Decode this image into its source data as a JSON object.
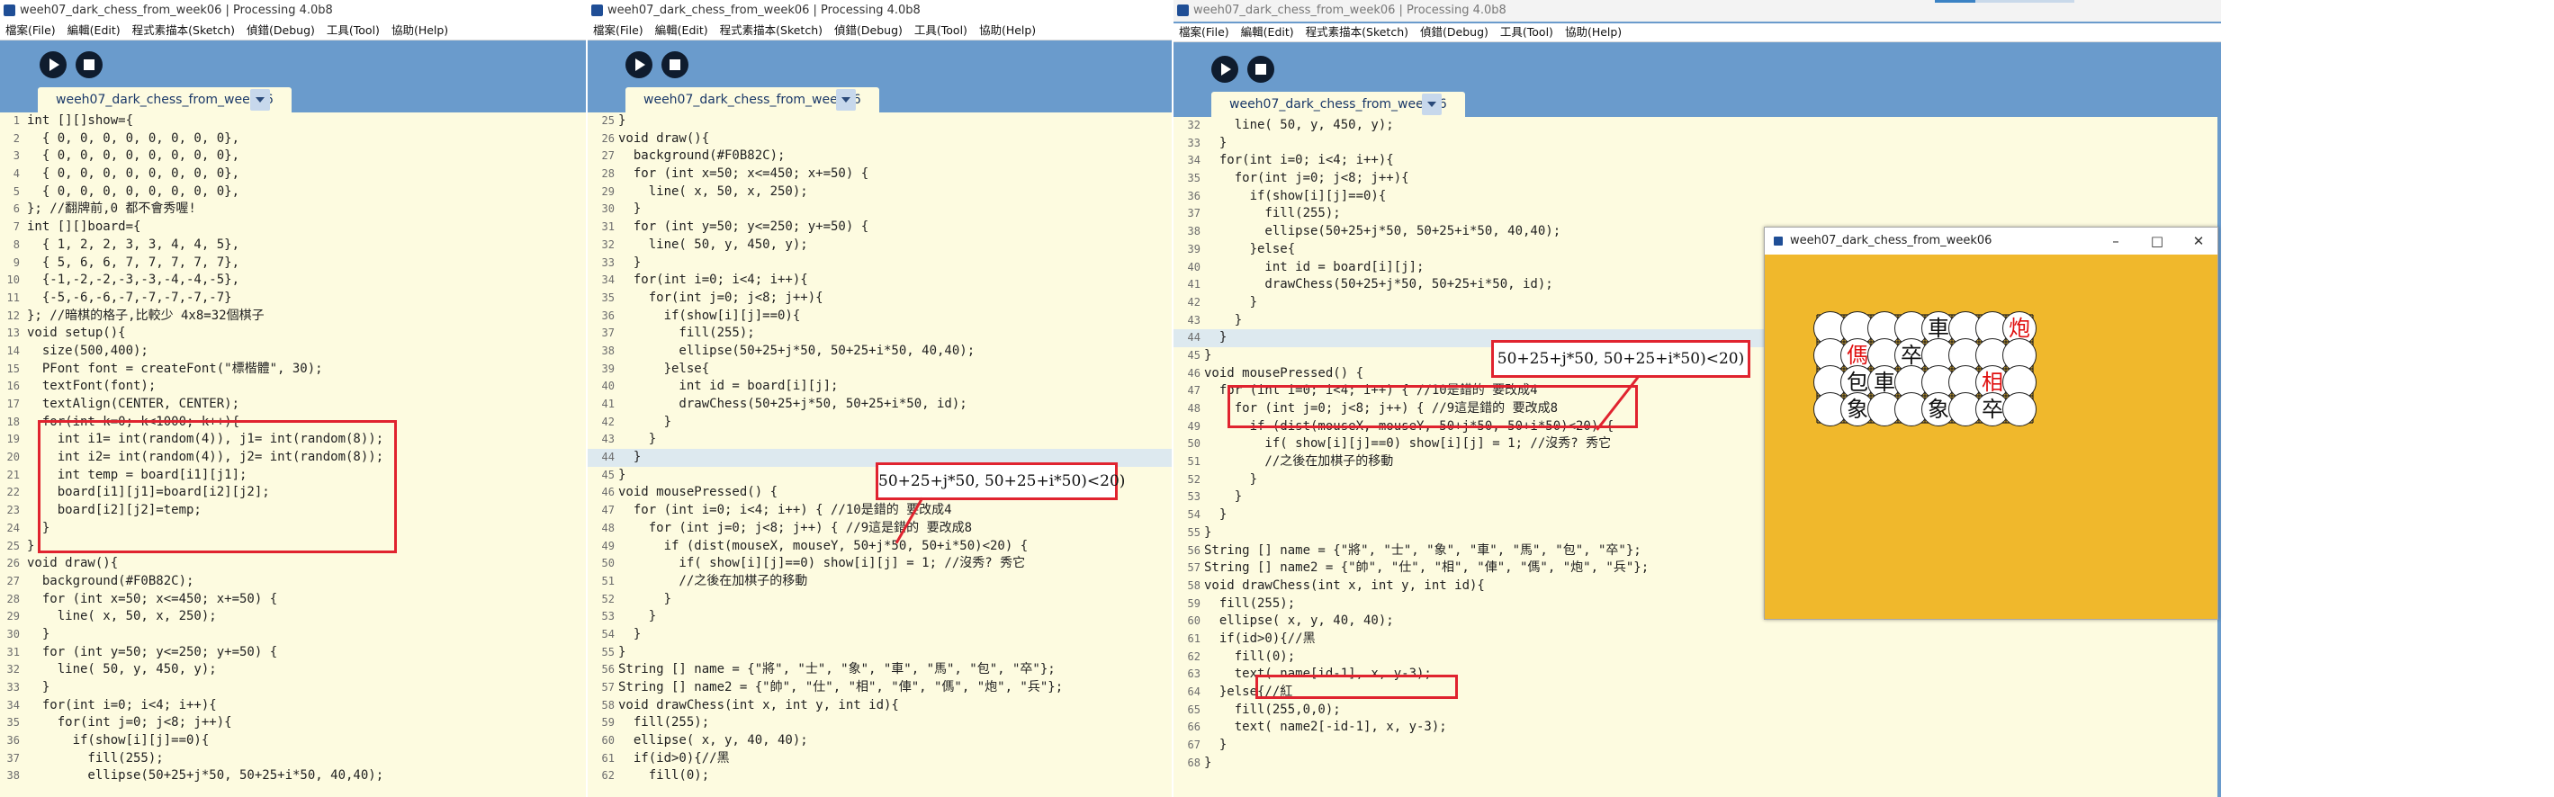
{
  "windows": [
    {
      "title": "weeh07_dark_chess_from_week06 | Processing 4.0b8",
      "tab": "weeh07_dark_chess_from_week06",
      "first_line": 1,
      "highlight_line": null,
      "lines": [
        "int [][]show={",
        "  { 0, 0, 0, 0, 0, 0, 0, 0},",
        "  { 0, 0, 0, 0, 0, 0, 0, 0},",
        "  { 0, 0, 0, 0, 0, 0, 0, 0},",
        "  { 0, 0, 0, 0, 0, 0, 0, 0},",
        "}; //翻牌前,0 都不會秀喔!",
        "int [][]board={",
        "  { 1, 2, 2, 3, 3, 4, 4, 5},",
        "  { 5, 6, 6, 7, 7, 7, 7, 7},",
        "  {-1,-2,-2,-3,-3,-4,-4,-5},",
        "  {-5,-6,-6,-7,-7,-7,-7,-7}",
        "}; //暗棋的格子,比較少 4x8=32個棋子",
        "void setup(){",
        "  size(500,400);",
        "  PFont font = createFont(\"標楷體\", 30);",
        "  textFont(font);",
        "  textAlign(CENTER, CENTER);",
        "  for(int k=0; k<1000; k++){",
        "    int i1= int(random(4)), j1= int(random(8));",
        "    int i2= int(random(4)), j2= int(random(8));",
        "    int temp = board[i1][j1];",
        "    board[i1][j1]=board[i2][j2];",
        "    board[i2][j2]=temp;",
        "  }",
        "}",
        "void draw(){",
        "  background(#F0B82C);",
        "  for (int x=50; x<=450; x+=50) {",
        "    line( x, 50, x, 250);",
        "  }",
        "  for (int y=50; y<=250; y+=50) {",
        "    line( 50, y, 450, y);",
        "  }",
        "  for(int i=0; i<4; i++){",
        "    for(int j=0; j<8; j++){",
        "      if(show[i][j]==0){",
        "        fill(255);",
        "        ellipse(50+25+j*50, 50+25+i*50, 40,40);"
      ]
    },
    {
      "title": "weeh07_dark_chess_from_week06 | Processing 4.0b8",
      "tab": "weeh07_dark_chess_from_week06",
      "first_line": 25,
      "highlight_line": 44,
      "lines": [
        "}",
        "void draw(){",
        "  background(#F0B82C);",
        "  for (int x=50; x<=450; x+=50) {",
        "    line( x, 50, x, 250);",
        "  }",
        "  for (int y=50; y<=250; y+=50) {",
        "    line( 50, y, 450, y);",
        "  }",
        "  for(int i=0; i<4; i++){",
        "    for(int j=0; j<8; j++){",
        "      if(show[i][j]==0){",
        "        fill(255);",
        "        ellipse(50+25+j*50, 50+25+i*50, 40,40);",
        "      }else{",
        "        int id = board[i][j];",
        "        drawChess(50+25+j*50, 50+25+i*50, id);",
        "      }",
        "    }",
        "  }",
        "}",
        "void mousePressed() {",
        "  for (int i=0; i<4; i++) { //10是錯的 要改成4",
        "    for (int j=0; j<8; j++) { //9這是錯的 要改成8",
        "      if (dist(mouseX, mouseY, 50+j*50, 50+i*50)<20) {",
        "        if( show[i][j]==0) show[i][j] = 1; //沒秀? 秀它",
        "        //之後在加棋子的移動",
        "      }",
        "    }",
        "  }",
        "}",
        "String [] name = {\"將\", \"士\", \"象\", \"車\", \"馬\", \"包\", \"卒\"};",
        "String [] name2 = {\"帥\", \"仕\", \"相\", \"俥\", \"傌\", \"炮\", \"兵\"};",
        "void drawChess(int x, int y, int id){",
        "  fill(255);",
        "  ellipse( x, y, 40, 40);",
        "  if(id>0){//黑",
        "    fill(0);"
      ]
    },
    {
      "title": "weeh07_dark_chess_from_week06 | Processing 4.0b8",
      "tab": "weeh07_dark_chess_from_week06",
      "first_line": 32,
      "highlight_line": 44,
      "lines": [
        "    line( 50, y, 450, y);",
        "  }",
        "  for(int i=0; i<4; i++){",
        "    for(int j=0; j<8; j++){",
        "      if(show[i][j]==0){",
        "        fill(255);",
        "        ellipse(50+25+j*50, 50+25+i*50, 40,40);",
        "      }else{",
        "        int id = board[i][j];",
        "        drawChess(50+25+j*50, 50+25+i*50, id);",
        "      }",
        "    }",
        "  }",
        "}",
        "void mousePressed() {",
        "  for (int i=0; i<4; i++) { //10是錯的 要改成4",
        "    for (int j=0; j<8; j++) { //9這是錯的 要改成8",
        "      if (dist(mouseX, mouseY, 50+j*50, 50+i*50)<20) {",
        "        if( show[i][j]==0) show[i][j] = 1; //沒秀? 秀它",
        "        //之後在加棋子的移動",
        "      }",
        "    }",
        "  }",
        "}",
        "String [] name = {\"將\", \"士\", \"象\", \"車\", \"馬\", \"包\", \"卒\"};",
        "String [] name2 = {\"帥\", \"仕\", \"相\", \"俥\", \"傌\", \"炮\", \"兵\"};",
        "void drawChess(int x, int y, int id){",
        "  fill(255);",
        "  ellipse( x, y, 40, 40);",
        "  if(id>0){//黑",
        "    fill(0);",
        "    text( name[id-1], x, y-3);",
        "  }else{//紅",
        "    fill(255,0,0);",
        "    text( name2[-id-1], x, y-3);",
        "  }",
        "}"
      ]
    }
  ],
  "menu": [
    "檔案(File)",
    "編輯(Edit)",
    "程式素描本(Sketch)",
    "偵錯(Debug)",
    "工具(Tool)",
    "協助(Help)"
  ],
  "callouts": {
    "mid": "50+25+j*50,  50+25+i*50)<20)",
    "right": "50+25+j*50,  50+25+i*50)<20)"
  },
  "sketch": {
    "title": "weeh07_dark_chess_from_week06",
    "pieces": [
      [
        "",
        "",
        "",
        "",
        "車",
        "",
        "",
        "炮"
      ],
      [
        "",
        "傌",
        "",
        "卒",
        "",
        "",
        "",
        ""
      ],
      [
        "",
        "包",
        "車",
        "",
        "",
        "",
        "相",
        ""
      ],
      [
        "",
        "象",
        "",
        "",
        "象",
        "",
        "卒",
        ""
      ]
    ],
    "red_pieces": [
      "炮",
      "傌",
      "相"
    ],
    "board_color": "#F0B82C"
  },
  "colors": {
    "accent_red": "#E0232F",
    "toolbar_blue": "#6A9BCC",
    "editor_bg": "#FDFBE0"
  }
}
